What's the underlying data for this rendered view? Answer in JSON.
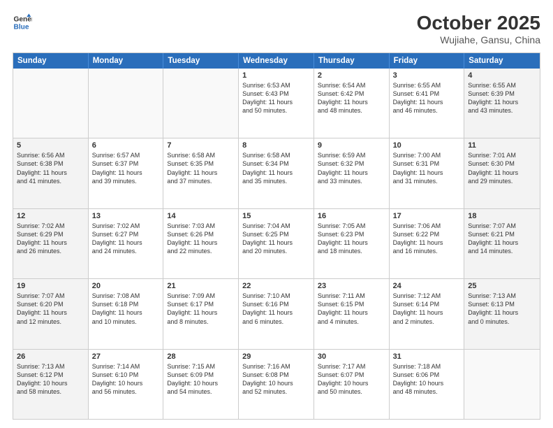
{
  "header": {
    "logo_general": "General",
    "logo_blue": "Blue",
    "title": "October 2025",
    "subtitle": "Wujiahe, Gansu, China"
  },
  "days_of_week": [
    "Sunday",
    "Monday",
    "Tuesday",
    "Wednesday",
    "Thursday",
    "Friday",
    "Saturday"
  ],
  "weeks": [
    [
      {
        "day": "",
        "empty": true
      },
      {
        "day": "",
        "empty": true
      },
      {
        "day": "",
        "empty": true
      },
      {
        "day": "1",
        "line1": "Sunrise: 6:53 AM",
        "line2": "Sunset: 6:43 PM",
        "line3": "Daylight: 11 hours",
        "line4": "and 50 minutes."
      },
      {
        "day": "2",
        "line1": "Sunrise: 6:54 AM",
        "line2": "Sunset: 6:42 PM",
        "line3": "Daylight: 11 hours",
        "line4": "and 48 minutes."
      },
      {
        "day": "3",
        "line1": "Sunrise: 6:55 AM",
        "line2": "Sunset: 6:41 PM",
        "line3": "Daylight: 11 hours",
        "line4": "and 46 minutes."
      },
      {
        "day": "4",
        "line1": "Sunrise: 6:55 AM",
        "line2": "Sunset: 6:39 PM",
        "line3": "Daylight: 11 hours",
        "line4": "and 43 minutes."
      }
    ],
    [
      {
        "day": "5",
        "line1": "Sunrise: 6:56 AM",
        "line2": "Sunset: 6:38 PM",
        "line3": "Daylight: 11 hours",
        "line4": "and 41 minutes."
      },
      {
        "day": "6",
        "line1": "Sunrise: 6:57 AM",
        "line2": "Sunset: 6:37 PM",
        "line3": "Daylight: 11 hours",
        "line4": "and 39 minutes."
      },
      {
        "day": "7",
        "line1": "Sunrise: 6:58 AM",
        "line2": "Sunset: 6:35 PM",
        "line3": "Daylight: 11 hours",
        "line4": "and 37 minutes."
      },
      {
        "day": "8",
        "line1": "Sunrise: 6:58 AM",
        "line2": "Sunset: 6:34 PM",
        "line3": "Daylight: 11 hours",
        "line4": "and 35 minutes."
      },
      {
        "day": "9",
        "line1": "Sunrise: 6:59 AM",
        "line2": "Sunset: 6:32 PM",
        "line3": "Daylight: 11 hours",
        "line4": "and 33 minutes."
      },
      {
        "day": "10",
        "line1": "Sunrise: 7:00 AM",
        "line2": "Sunset: 6:31 PM",
        "line3": "Daylight: 11 hours",
        "line4": "and 31 minutes."
      },
      {
        "day": "11",
        "line1": "Sunrise: 7:01 AM",
        "line2": "Sunset: 6:30 PM",
        "line3": "Daylight: 11 hours",
        "line4": "and 29 minutes."
      }
    ],
    [
      {
        "day": "12",
        "line1": "Sunrise: 7:02 AM",
        "line2": "Sunset: 6:29 PM",
        "line3": "Daylight: 11 hours",
        "line4": "and 26 minutes."
      },
      {
        "day": "13",
        "line1": "Sunrise: 7:02 AM",
        "line2": "Sunset: 6:27 PM",
        "line3": "Daylight: 11 hours",
        "line4": "and 24 minutes."
      },
      {
        "day": "14",
        "line1": "Sunrise: 7:03 AM",
        "line2": "Sunset: 6:26 PM",
        "line3": "Daylight: 11 hours",
        "line4": "and 22 minutes."
      },
      {
        "day": "15",
        "line1": "Sunrise: 7:04 AM",
        "line2": "Sunset: 6:25 PM",
        "line3": "Daylight: 11 hours",
        "line4": "and 20 minutes."
      },
      {
        "day": "16",
        "line1": "Sunrise: 7:05 AM",
        "line2": "Sunset: 6:23 PM",
        "line3": "Daylight: 11 hours",
        "line4": "and 18 minutes."
      },
      {
        "day": "17",
        "line1": "Sunrise: 7:06 AM",
        "line2": "Sunset: 6:22 PM",
        "line3": "Daylight: 11 hours",
        "line4": "and 16 minutes."
      },
      {
        "day": "18",
        "line1": "Sunrise: 7:07 AM",
        "line2": "Sunset: 6:21 PM",
        "line3": "Daylight: 11 hours",
        "line4": "and 14 minutes."
      }
    ],
    [
      {
        "day": "19",
        "line1": "Sunrise: 7:07 AM",
        "line2": "Sunset: 6:20 PM",
        "line3": "Daylight: 11 hours",
        "line4": "and 12 minutes."
      },
      {
        "day": "20",
        "line1": "Sunrise: 7:08 AM",
        "line2": "Sunset: 6:18 PM",
        "line3": "Daylight: 11 hours",
        "line4": "and 10 minutes."
      },
      {
        "day": "21",
        "line1": "Sunrise: 7:09 AM",
        "line2": "Sunset: 6:17 PM",
        "line3": "Daylight: 11 hours",
        "line4": "and 8 minutes."
      },
      {
        "day": "22",
        "line1": "Sunrise: 7:10 AM",
        "line2": "Sunset: 6:16 PM",
        "line3": "Daylight: 11 hours",
        "line4": "and 6 minutes."
      },
      {
        "day": "23",
        "line1": "Sunrise: 7:11 AM",
        "line2": "Sunset: 6:15 PM",
        "line3": "Daylight: 11 hours",
        "line4": "and 4 minutes."
      },
      {
        "day": "24",
        "line1": "Sunrise: 7:12 AM",
        "line2": "Sunset: 6:14 PM",
        "line3": "Daylight: 11 hours",
        "line4": "and 2 minutes."
      },
      {
        "day": "25",
        "line1": "Sunrise: 7:13 AM",
        "line2": "Sunset: 6:13 PM",
        "line3": "Daylight: 11 hours",
        "line4": "and 0 minutes."
      }
    ],
    [
      {
        "day": "26",
        "line1": "Sunrise: 7:13 AM",
        "line2": "Sunset: 6:12 PM",
        "line3": "Daylight: 10 hours",
        "line4": "and 58 minutes."
      },
      {
        "day": "27",
        "line1": "Sunrise: 7:14 AM",
        "line2": "Sunset: 6:10 PM",
        "line3": "Daylight: 10 hours",
        "line4": "and 56 minutes."
      },
      {
        "day": "28",
        "line1": "Sunrise: 7:15 AM",
        "line2": "Sunset: 6:09 PM",
        "line3": "Daylight: 10 hours",
        "line4": "and 54 minutes."
      },
      {
        "day": "29",
        "line1": "Sunrise: 7:16 AM",
        "line2": "Sunset: 6:08 PM",
        "line3": "Daylight: 10 hours",
        "line4": "and 52 minutes."
      },
      {
        "day": "30",
        "line1": "Sunrise: 7:17 AM",
        "line2": "Sunset: 6:07 PM",
        "line3": "Daylight: 10 hours",
        "line4": "and 50 minutes."
      },
      {
        "day": "31",
        "line1": "Sunrise: 7:18 AM",
        "line2": "Sunset: 6:06 PM",
        "line3": "Daylight: 10 hours",
        "line4": "and 48 minutes."
      },
      {
        "day": "",
        "empty": true
      }
    ]
  ]
}
